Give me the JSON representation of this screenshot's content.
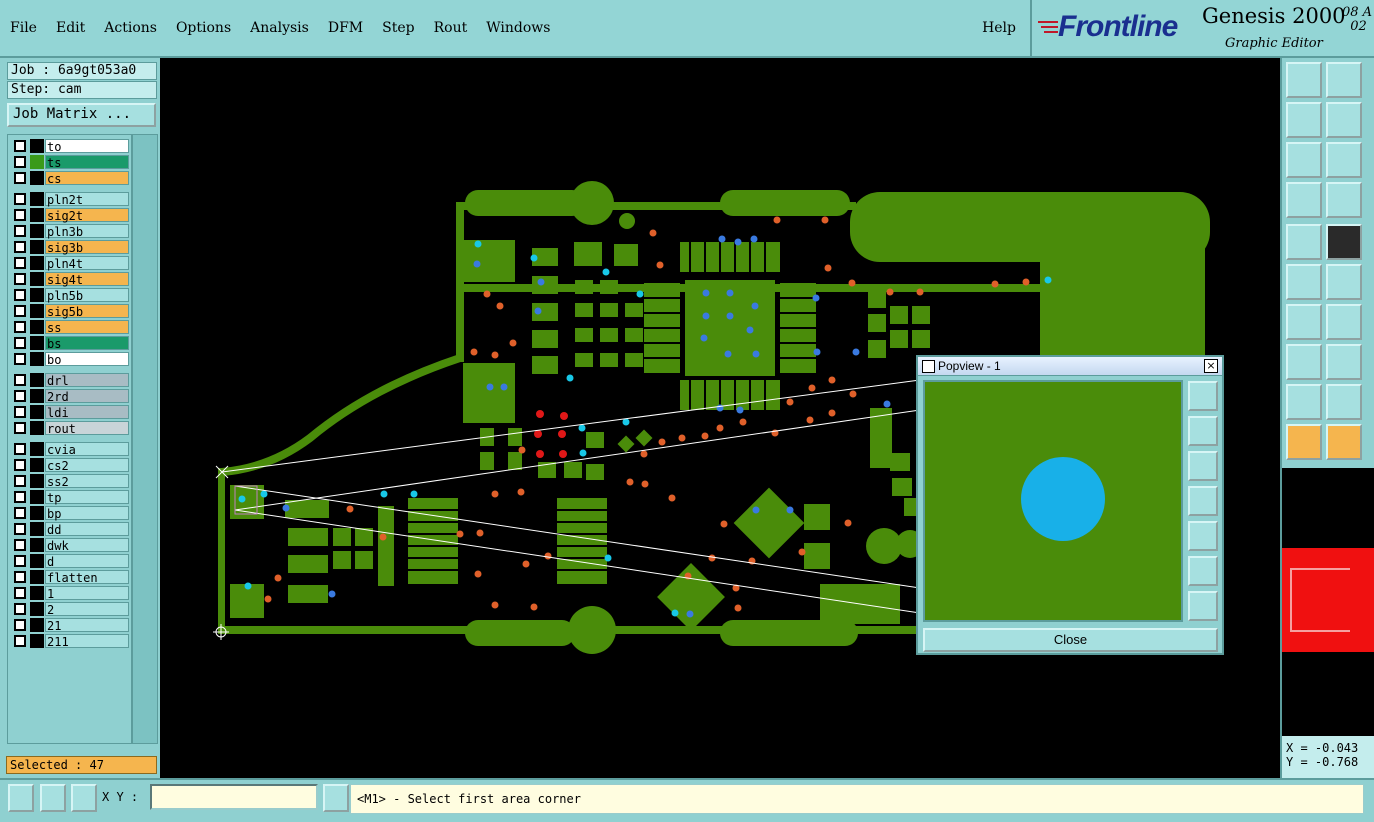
{
  "menu": {
    "items": [
      {
        "label": "File"
      },
      {
        "label": "Edit"
      },
      {
        "label": "Actions"
      },
      {
        "label": "Options"
      },
      {
        "label": "Analysis"
      },
      {
        "label": "DFM"
      },
      {
        "label": "Step"
      },
      {
        "label": "Rout"
      },
      {
        "label": "Windows"
      }
    ],
    "help": "Help"
  },
  "brand": {
    "logo": "Frontline",
    "product": "Genesis 2000",
    "version_line1": "08 A",
    "version_line2": "02",
    "subtitle": "Graphic Editor"
  },
  "left": {
    "job": "Job : 6a9gt053a0",
    "step": "Step: cam",
    "job_matrix": "Job Matrix ...",
    "selected": "Selected : 47"
  },
  "layers": [
    {
      "name": "to",
      "color": "#ffffff"
    },
    {
      "name": "ts",
      "color": "#1a9a6a",
      "swatch": "#3a9a1a"
    },
    {
      "name": "cs",
      "color": "#f5b54e"
    },
    {
      "name": "pln2t",
      "color": "#a6e0e0"
    },
    {
      "name": "sig2t",
      "color": "#f5b54e"
    },
    {
      "name": "pln3b",
      "color": "#a6e0e0"
    },
    {
      "name": "sig3b",
      "color": "#f5b54e"
    },
    {
      "name": "pln4t",
      "color": "#a6e0e0"
    },
    {
      "name": "sig4t",
      "color": "#f5b54e"
    },
    {
      "name": "pln5b",
      "color": "#a6e0e0"
    },
    {
      "name": "sig5b",
      "color": "#f5b54e"
    },
    {
      "name": "ss",
      "color": "#f5b54e"
    },
    {
      "name": "bs",
      "color": "#1a9a6a"
    },
    {
      "name": "bo",
      "color": "#ffffff"
    },
    {
      "name": "drl",
      "color": "#a8bcc4"
    },
    {
      "name": "2rd",
      "color": "#a8bcc4"
    },
    {
      "name": "ldi",
      "color": "#a8bcc4"
    },
    {
      "name": "rout",
      "color": "#c8d4d8"
    },
    {
      "name": "cvia",
      "color": "#a6e0e0"
    },
    {
      "name": "cs2",
      "color": "#a6e0e0"
    },
    {
      "name": "ss2",
      "color": "#a6e0e0"
    },
    {
      "name": "tp",
      "color": "#a6e0e0"
    },
    {
      "name": "bp",
      "color": "#a6e0e0"
    },
    {
      "name": "dd",
      "color": "#a6e0e0"
    },
    {
      "name": "dwk",
      "color": "#a6e0e0"
    },
    {
      "name": "d",
      "color": "#a6e0e0"
    },
    {
      "name": "flatten",
      "color": "#a6e0e0"
    },
    {
      "name": "1",
      "color": "#a6e0e0"
    },
    {
      "name": "2",
      "color": "#a6e0e0"
    },
    {
      "name": "21",
      "color": "#a6e0e0"
    },
    {
      "name": "211",
      "color": "#a6e0e0"
    }
  ],
  "popview": {
    "title": "Popview - 1",
    "close": "Close"
  },
  "coords": {
    "x": "X = -0.043",
    "y": "Y = -0.768"
  },
  "bottom": {
    "xy_label": "X Y :",
    "xy_value": "",
    "prompt": "<M1> - Select first area corner"
  },
  "colors": {
    "board": "#4a8c0a",
    "pad_orange": "#e0602a",
    "pad_blue": "#3a7ae0",
    "pad_cyan": "#18c8e8",
    "pad_red": "#e01818",
    "hilite": "#f5b54e"
  }
}
